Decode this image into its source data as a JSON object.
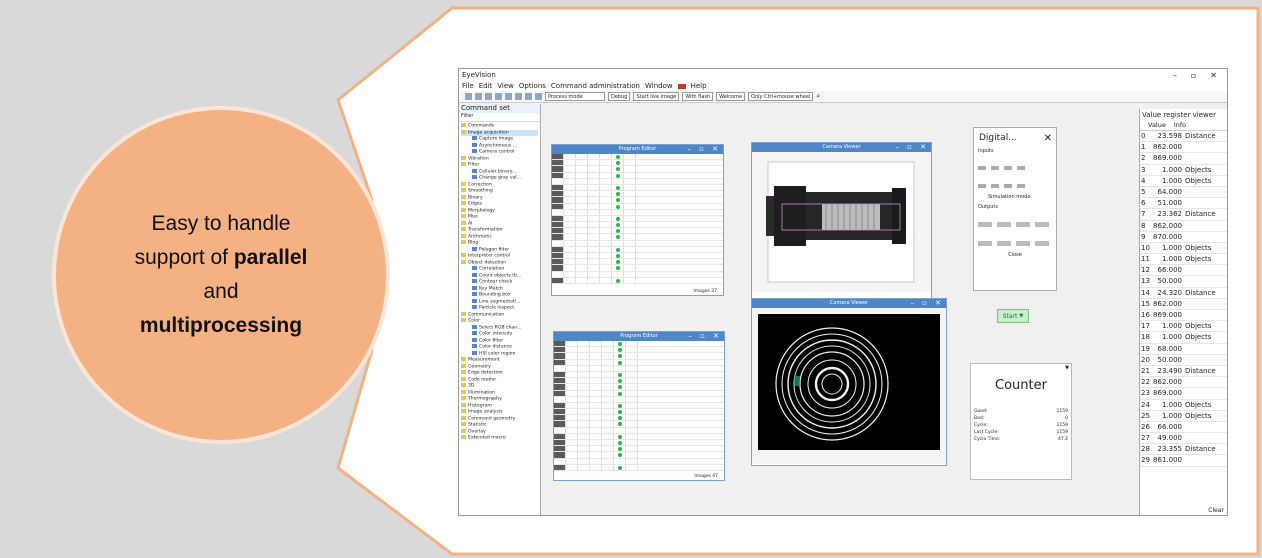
{
  "callout": {
    "line1": "Easy to handle",
    "line2_prefix": "support of ",
    "line2_bold": "parallel",
    "line3": "and",
    "line4_bold": "multiprocessing",
    "fill_color": "#f4b183"
  },
  "app": {
    "title": "EyeVision",
    "menu": [
      "File",
      "Edit",
      "View",
      "Options",
      "Command administration",
      "Window",
      "Help"
    ],
    "toolbar": {
      "mode_select": "Process mode",
      "debug": "Debug",
      "start_live": "Start live image",
      "with_flash": "With flash",
      "welcome": "Welcome",
      "only_ctrl": "Only Ctrl+mouse wheel"
    }
  },
  "command_set": {
    "title": "Command set",
    "filter": "Filter",
    "items": [
      {
        "label": "Commands",
        "level": 0
      },
      {
        "label": "Image acquisition",
        "level": 0
      },
      {
        "label": "Capture image",
        "level": 1
      },
      {
        "label": "Asynchronous ...",
        "level": 1
      },
      {
        "label": "Camera control",
        "level": 1
      },
      {
        "label": "Vibration",
        "level": 0
      },
      {
        "label": "Filter",
        "level": 0
      },
      {
        "label": "Cellular binary...",
        "level": 1
      },
      {
        "label": "Change gray val...",
        "level": 1
      },
      {
        "label": "Correction",
        "level": 0
      },
      {
        "label": "Smoothing",
        "level": 0
      },
      {
        "label": "Binary",
        "level": 0
      },
      {
        "label": "Edges",
        "level": 0
      },
      {
        "label": "Morphology",
        "level": 0
      },
      {
        "label": "Misc",
        "level": 0
      },
      {
        "label": "AI",
        "level": 0
      },
      {
        "label": "Transformation",
        "level": 0
      },
      {
        "label": "Arithmetic",
        "level": 0
      },
      {
        "label": "Blog",
        "level": 0
      },
      {
        "label": "Polygon filter",
        "level": 1
      },
      {
        "label": "Interpreter control",
        "level": 0
      },
      {
        "label": "Object detection",
        "level": 0
      },
      {
        "label": "Correlation",
        "level": 1
      },
      {
        "label": "Count objects (b...",
        "level": 1
      },
      {
        "label": "Contour check",
        "level": 1
      },
      {
        "label": "Key Match",
        "level": 1
      },
      {
        "label": "Bounding box",
        "level": 1
      },
      {
        "label": "Line segmentati...",
        "level": 1
      },
      {
        "label": "Particle inspect.",
        "level": 1
      },
      {
        "label": "Communication",
        "level": 0
      },
      {
        "label": "Color",
        "level": 0
      },
      {
        "label": "Select RGB chan...",
        "level": 1
      },
      {
        "label": "Color intensity",
        "level": 1
      },
      {
        "label": "Color filter",
        "level": 1
      },
      {
        "label": "Color distance",
        "level": 1
      },
      {
        "label": "HSI color region",
        "level": 1
      },
      {
        "label": "Measurement",
        "level": 0
      },
      {
        "label": "Geometry",
        "level": 0
      },
      {
        "label": "Edge detection",
        "level": 0
      },
      {
        "label": "Code reader",
        "level": 0
      },
      {
        "label": "3D",
        "level": 0
      },
      {
        "label": "Illumination",
        "level": 0
      },
      {
        "label": "Thermography",
        "level": 0
      },
      {
        "label": "Histogram",
        "level": 0
      },
      {
        "label": "Image analysis",
        "level": 0
      },
      {
        "label": "Command geometry",
        "level": 0
      },
      {
        "label": "Statistic",
        "level": 0
      },
      {
        "label": "Overlay",
        "level": 0
      },
      {
        "label": "Extended macro",
        "level": 0
      }
    ]
  },
  "program_editor_1": {
    "title": "Program Editor",
    "footer": "Images 27"
  },
  "program_editor_2": {
    "title": "Program Editor",
    "footer": "Images 47"
  },
  "camera_viewer_1": {
    "title": "Camera Viewer"
  },
  "camera_viewer_2": {
    "title": "Camera Viewer"
  },
  "digital_io": {
    "title": "Digital...",
    "inputs_label": "Inputs",
    "simulation_label": "Simulation mode",
    "outputs_label": "Outputs",
    "close_label": "Close"
  },
  "start_button": "Start",
  "counter": {
    "title": "Counter",
    "rows": [
      {
        "label": "Good:",
        "value": "1159"
      },
      {
        "label": "Bad:",
        "value": "0"
      },
      {
        "label": "Cycle:",
        "value": "1159"
      },
      {
        "label": "Last Cycle:",
        "value": "1159"
      },
      {
        "label": "Cycle Time:",
        "value": "47.2"
      }
    ]
  },
  "value_register": {
    "title": "Value register viewer",
    "columns": [
      "Value",
      "Info"
    ],
    "rows": [
      {
        "i": "0",
        "v": "23.598",
        "info": "Distance"
      },
      {
        "i": "1",
        "v": "862.000",
        "info": ""
      },
      {
        "i": "2",
        "v": "869.000",
        "info": ""
      },
      {
        "i": "3",
        "v": "1.000",
        "info": "Objects"
      },
      {
        "i": "4",
        "v": "1.000",
        "info": "Objects"
      },
      {
        "i": "5",
        "v": "64.000",
        "info": ""
      },
      {
        "i": "6",
        "v": "51.000",
        "info": ""
      },
      {
        "i": "7",
        "v": "23.362",
        "info": "Distance"
      },
      {
        "i": "8",
        "v": "862.000",
        "info": ""
      },
      {
        "i": "9",
        "v": "870.000",
        "info": ""
      },
      {
        "i": "10",
        "v": "1.000",
        "info": "Objects"
      },
      {
        "i": "11",
        "v": "1.000",
        "info": "Objects"
      },
      {
        "i": "12",
        "v": "66.000",
        "info": ""
      },
      {
        "i": "13",
        "v": "50.000",
        "info": ""
      },
      {
        "i": "14",
        "v": "24.320",
        "info": "Distance"
      },
      {
        "i": "15",
        "v": "862.000",
        "info": ""
      },
      {
        "i": "16",
        "v": "869.000",
        "info": ""
      },
      {
        "i": "17",
        "v": "1.000",
        "info": "Objects"
      },
      {
        "i": "18",
        "v": "1.000",
        "info": "Objects"
      },
      {
        "i": "19",
        "v": "68.000",
        "info": ""
      },
      {
        "i": "20",
        "v": "50.000",
        "info": ""
      },
      {
        "i": "21",
        "v": "23.490",
        "info": "Distance"
      },
      {
        "i": "22",
        "v": "862.000",
        "info": ""
      },
      {
        "i": "23",
        "v": "869.000",
        "info": ""
      },
      {
        "i": "24",
        "v": "1.000",
        "info": "Objects"
      },
      {
        "i": "25",
        "v": "1.000",
        "info": "Objects"
      },
      {
        "i": "26",
        "v": "66.000",
        "info": ""
      },
      {
        "i": "27",
        "v": "49.000",
        "info": ""
      },
      {
        "i": "28",
        "v": "23.355",
        "info": "Distance"
      },
      {
        "i": "29",
        "v": "861.000",
        "info": ""
      }
    ],
    "clear_label": "Clear"
  }
}
